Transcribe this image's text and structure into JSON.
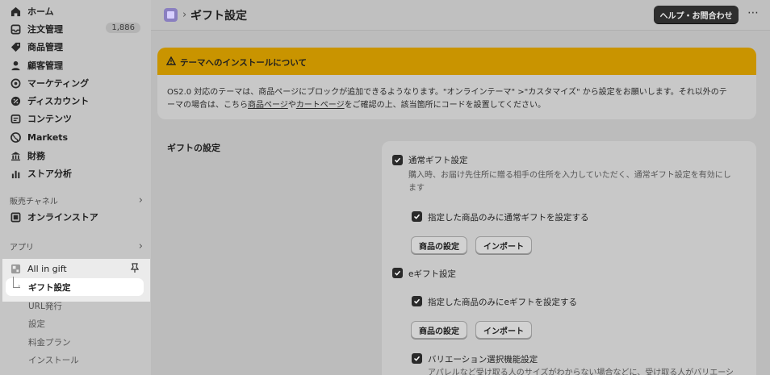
{
  "nav": {
    "home": "ホーム",
    "orders": "注文管理",
    "orders_count": "1,886",
    "products": "商品管理",
    "customers": "顧客管理",
    "marketing": "マーケティング",
    "discounts": "ディスカウント",
    "content": "コンテンツ",
    "markets": "Markets",
    "finance": "財務",
    "analytics": "ストア分析",
    "sales_channels": "販売チャネル",
    "online_store": "オンラインストア",
    "apps": "アプリ",
    "app_name": "All in gift",
    "app_sub": [
      "ギフト設定",
      "URL発行",
      "設定",
      "料金プラン",
      "インストール"
    ]
  },
  "header": {
    "title": "ギフト設定",
    "help_button": "ヘルプ・お問合わせ",
    "more": "⋯"
  },
  "banner": {
    "title": "テーマへのインストールについて",
    "line1": "OS2.0 対応のテーマは、商品ページにブロックが追加できるようなります。\"オンラインテーマ\" >\"カスタマイズ\" から設定をお願いします。それ以外のテ",
    "line2_pre": "ーマの場合は、こちら",
    "link1": "商品ページ",
    "mid": "や",
    "link2": "カートページ",
    "line2_post": "をご確認の上、該当箇所にコードを設置してください。"
  },
  "gift": {
    "section_title": "ギフトの設定",
    "normal_label": "通常ギフト設定",
    "normal_desc1": "購入時、お届け先住所に贈る相手の住所を入力していただく、通常ギフト設定を有効にし",
    "normal_desc2": "ます",
    "normal_only": "指定した商品のみに通常ギフトを設定する",
    "egift_label": "eギフト設定",
    "egift_only": "指定した商品のみにeギフトを設定する",
    "variation_label": "バリエーション選択機能設定",
    "variation_desc": "アパレルなど受け取る人のサイズがわからない場合などに、受け取る人がバリエーシ",
    "product_settings_btn": "商品の設定",
    "import_btn": "インポート"
  },
  "colors": {
    "banner": "#c99400",
    "sidebar": "#c5c5c5",
    "highlight": "#ebebeb"
  }
}
